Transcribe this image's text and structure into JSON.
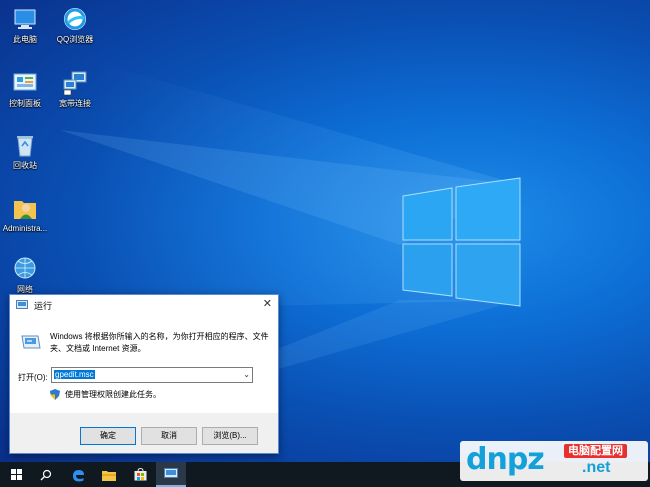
{
  "desktop": {
    "icons": [
      {
        "label": "此电脑",
        "icon": "this-pc-icon"
      },
      {
        "label": "QQ浏览器",
        "icon": "qq-browser-icon"
      },
      {
        "label": "控制面板",
        "icon": "control-panel-icon"
      },
      {
        "label": "宽带连接",
        "icon": "broadband-icon"
      },
      {
        "label": "回收站",
        "icon": "recycle-bin-icon"
      },
      {
        "label": "Administra...",
        "icon": "user-folder-icon"
      },
      {
        "label": "网络",
        "icon": "network-icon"
      }
    ]
  },
  "run_dialog": {
    "title": "运行",
    "description": "Windows 将根据你所输入的名称，为你打开相应的程序、文件夹、文档或 Internet 资源。",
    "open_label": "打开(O):",
    "open_value": "gpedit.msc",
    "admin_text": "使用管理权限创建此任务。",
    "ok_label": "确定",
    "cancel_label": "取消",
    "browse_label": "浏览(B)..."
  },
  "watermark": {
    "main": "dnpz",
    "chinese": "电脑配置网",
    "domain": ".net"
  },
  "colors": {
    "accent": "#0078d7",
    "taskbar": "#101820"
  }
}
